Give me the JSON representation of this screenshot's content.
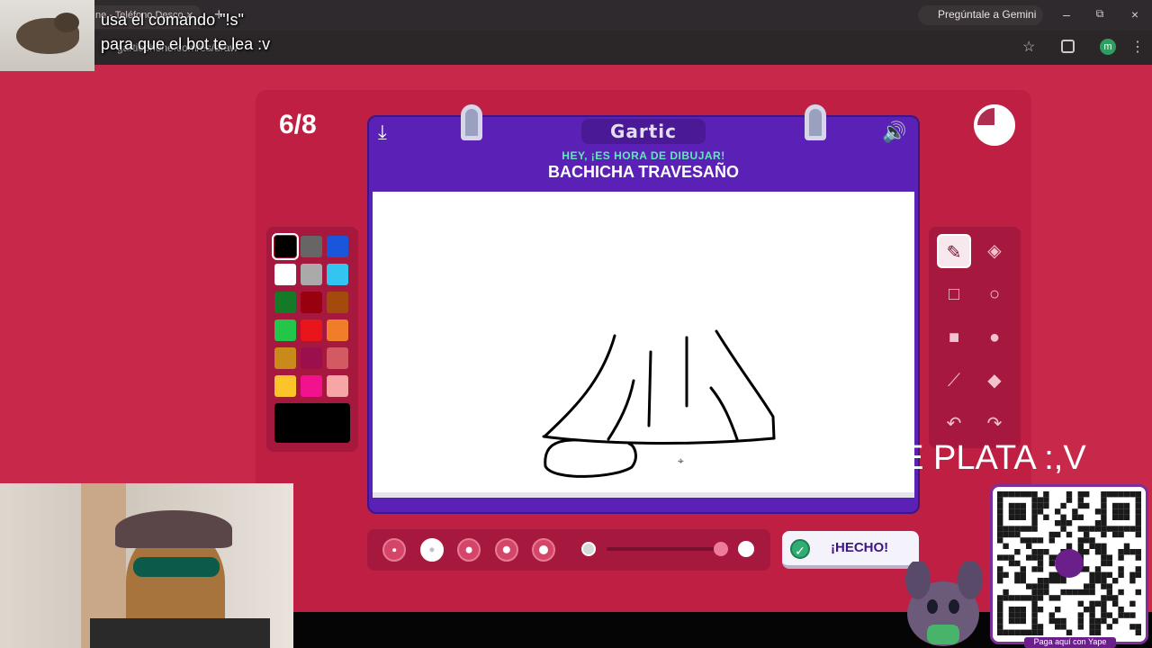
{
  "browser": {
    "tab_title": "ne - Teléfono Desco...",
    "tab_close": "×",
    "new_tab": "+",
    "gemini_label": "Pregúntale a Gemini",
    "url": "garticphone.com/es/draw",
    "profile_initial": "m",
    "window_controls": {
      "minimize": "–",
      "restore": "⧉",
      "close": "×"
    }
  },
  "stream_overlay": {
    "line1": "usa el comando \"!s\"",
    "line2": "para que el bot te lea :v",
    "marquee": "NME PLATA :,V",
    "qr_caption": "Paga aquí con Yape"
  },
  "game": {
    "round": "6/8",
    "logo": "Gartic",
    "subtitle": "HEY, ¡ES HORA DE DIBUJAR!",
    "prompt": "BACHICHA TRAVESAÑO",
    "done_label": "¡HECHO!",
    "palette": [
      "#000000",
      "#666666",
      "#1a56db",
      "#ffffff",
      "#aaaaaa",
      "#33c4f2",
      "#147a27",
      "#99000f",
      "#a54a0d",
      "#22c74a",
      "#e8151b",
      "#f07d2a",
      "#c88a1b",
      "#9b0f4c",
      "#d35a63",
      "#fbc42b",
      "#f2128d",
      "#f7a5a5"
    ],
    "current_color": "#000000",
    "brush_sizes": [
      1,
      2,
      3,
      4,
      5
    ],
    "selected_brush_size": 2,
    "tools": [
      {
        "name": "pencil-tool",
        "icon": "✎",
        "active": true
      },
      {
        "name": "eraser-tool",
        "icon": "◈",
        "active": false
      },
      {
        "name": "rectangle-outline-tool",
        "icon": "□",
        "active": false
      },
      {
        "name": "ellipse-outline-tool",
        "icon": "○",
        "active": false
      },
      {
        "name": "rectangle-fill-tool",
        "icon": "■",
        "active": false
      },
      {
        "name": "ellipse-fill-tool",
        "icon": "●",
        "active": false
      },
      {
        "name": "line-tool",
        "icon": "⟋",
        "active": false
      },
      {
        "name": "fill-bucket-tool",
        "icon": "◆",
        "active": false
      },
      {
        "name": "undo-tool",
        "icon": "↶",
        "active": false
      },
      {
        "name": "redo-tool",
        "icon": "↷",
        "active": false
      }
    ]
  }
}
